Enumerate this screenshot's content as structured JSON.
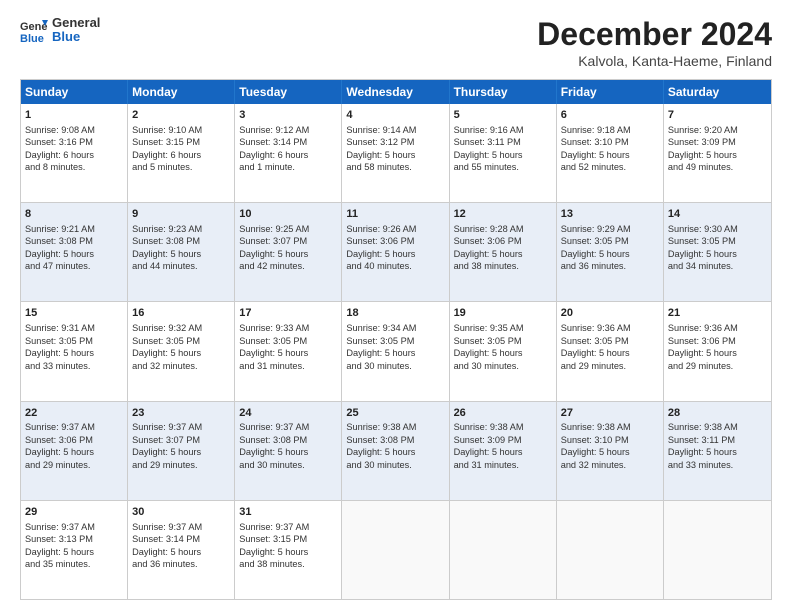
{
  "logo": {
    "line1": "General",
    "line2": "Blue"
  },
  "title": "December 2024",
  "subtitle": "Kalvola, Kanta-Haeme, Finland",
  "header_days": [
    "Sunday",
    "Monday",
    "Tuesday",
    "Wednesday",
    "Thursday",
    "Friday",
    "Saturday"
  ],
  "weeks": [
    [
      {
        "day": "1",
        "lines": [
          "Sunrise: 9:08 AM",
          "Sunset: 3:16 PM",
          "Daylight: 6 hours",
          "and 8 minutes."
        ]
      },
      {
        "day": "2",
        "lines": [
          "Sunrise: 9:10 AM",
          "Sunset: 3:15 PM",
          "Daylight: 6 hours",
          "and 5 minutes."
        ]
      },
      {
        "day": "3",
        "lines": [
          "Sunrise: 9:12 AM",
          "Sunset: 3:14 PM",
          "Daylight: 6 hours",
          "and 1 minute."
        ]
      },
      {
        "day": "4",
        "lines": [
          "Sunrise: 9:14 AM",
          "Sunset: 3:12 PM",
          "Daylight: 5 hours",
          "and 58 minutes."
        ]
      },
      {
        "day": "5",
        "lines": [
          "Sunrise: 9:16 AM",
          "Sunset: 3:11 PM",
          "Daylight: 5 hours",
          "and 55 minutes."
        ]
      },
      {
        "day": "6",
        "lines": [
          "Sunrise: 9:18 AM",
          "Sunset: 3:10 PM",
          "Daylight: 5 hours",
          "and 52 minutes."
        ]
      },
      {
        "day": "7",
        "lines": [
          "Sunrise: 9:20 AM",
          "Sunset: 3:09 PM",
          "Daylight: 5 hours",
          "and 49 minutes."
        ]
      }
    ],
    [
      {
        "day": "8",
        "lines": [
          "Sunrise: 9:21 AM",
          "Sunset: 3:08 PM",
          "Daylight: 5 hours",
          "and 47 minutes."
        ]
      },
      {
        "day": "9",
        "lines": [
          "Sunrise: 9:23 AM",
          "Sunset: 3:08 PM",
          "Daylight: 5 hours",
          "and 44 minutes."
        ]
      },
      {
        "day": "10",
        "lines": [
          "Sunrise: 9:25 AM",
          "Sunset: 3:07 PM",
          "Daylight: 5 hours",
          "and 42 minutes."
        ]
      },
      {
        "day": "11",
        "lines": [
          "Sunrise: 9:26 AM",
          "Sunset: 3:06 PM",
          "Daylight: 5 hours",
          "and 40 minutes."
        ]
      },
      {
        "day": "12",
        "lines": [
          "Sunrise: 9:28 AM",
          "Sunset: 3:06 PM",
          "Daylight: 5 hours",
          "and 38 minutes."
        ]
      },
      {
        "day": "13",
        "lines": [
          "Sunrise: 9:29 AM",
          "Sunset: 3:05 PM",
          "Daylight: 5 hours",
          "and 36 minutes."
        ]
      },
      {
        "day": "14",
        "lines": [
          "Sunrise: 9:30 AM",
          "Sunset: 3:05 PM",
          "Daylight: 5 hours",
          "and 34 minutes."
        ]
      }
    ],
    [
      {
        "day": "15",
        "lines": [
          "Sunrise: 9:31 AM",
          "Sunset: 3:05 PM",
          "Daylight: 5 hours",
          "and 33 minutes."
        ]
      },
      {
        "day": "16",
        "lines": [
          "Sunrise: 9:32 AM",
          "Sunset: 3:05 PM",
          "Daylight: 5 hours",
          "and 32 minutes."
        ]
      },
      {
        "day": "17",
        "lines": [
          "Sunrise: 9:33 AM",
          "Sunset: 3:05 PM",
          "Daylight: 5 hours",
          "and 31 minutes."
        ]
      },
      {
        "day": "18",
        "lines": [
          "Sunrise: 9:34 AM",
          "Sunset: 3:05 PM",
          "Daylight: 5 hours",
          "and 30 minutes."
        ]
      },
      {
        "day": "19",
        "lines": [
          "Sunrise: 9:35 AM",
          "Sunset: 3:05 PM",
          "Daylight: 5 hours",
          "and 30 minutes."
        ]
      },
      {
        "day": "20",
        "lines": [
          "Sunrise: 9:36 AM",
          "Sunset: 3:05 PM",
          "Daylight: 5 hours",
          "and 29 minutes."
        ]
      },
      {
        "day": "21",
        "lines": [
          "Sunrise: 9:36 AM",
          "Sunset: 3:06 PM",
          "Daylight: 5 hours",
          "and 29 minutes."
        ]
      }
    ],
    [
      {
        "day": "22",
        "lines": [
          "Sunrise: 9:37 AM",
          "Sunset: 3:06 PM",
          "Daylight: 5 hours",
          "and 29 minutes."
        ]
      },
      {
        "day": "23",
        "lines": [
          "Sunrise: 9:37 AM",
          "Sunset: 3:07 PM",
          "Daylight: 5 hours",
          "and 29 minutes."
        ]
      },
      {
        "day": "24",
        "lines": [
          "Sunrise: 9:37 AM",
          "Sunset: 3:08 PM",
          "Daylight: 5 hours",
          "and 30 minutes."
        ]
      },
      {
        "day": "25",
        "lines": [
          "Sunrise: 9:38 AM",
          "Sunset: 3:08 PM",
          "Daylight: 5 hours",
          "and 30 minutes."
        ]
      },
      {
        "day": "26",
        "lines": [
          "Sunrise: 9:38 AM",
          "Sunset: 3:09 PM",
          "Daylight: 5 hours",
          "and 31 minutes."
        ]
      },
      {
        "day": "27",
        "lines": [
          "Sunrise: 9:38 AM",
          "Sunset: 3:10 PM",
          "Daylight: 5 hours",
          "and 32 minutes."
        ]
      },
      {
        "day": "28",
        "lines": [
          "Sunrise: 9:38 AM",
          "Sunset: 3:11 PM",
          "Daylight: 5 hours",
          "and 33 minutes."
        ]
      }
    ],
    [
      {
        "day": "29",
        "lines": [
          "Sunrise: 9:37 AM",
          "Sunset: 3:13 PM",
          "Daylight: 5 hours",
          "and 35 minutes."
        ]
      },
      {
        "day": "30",
        "lines": [
          "Sunrise: 9:37 AM",
          "Sunset: 3:14 PM",
          "Daylight: 5 hours",
          "and 36 minutes."
        ]
      },
      {
        "day": "31",
        "lines": [
          "Sunrise: 9:37 AM",
          "Sunset: 3:15 PM",
          "Daylight: 5 hours",
          "and 38 minutes."
        ]
      },
      {
        "day": "",
        "lines": []
      },
      {
        "day": "",
        "lines": []
      },
      {
        "day": "",
        "lines": []
      },
      {
        "day": "",
        "lines": []
      }
    ]
  ],
  "alt_rows": [
    1,
    3
  ]
}
